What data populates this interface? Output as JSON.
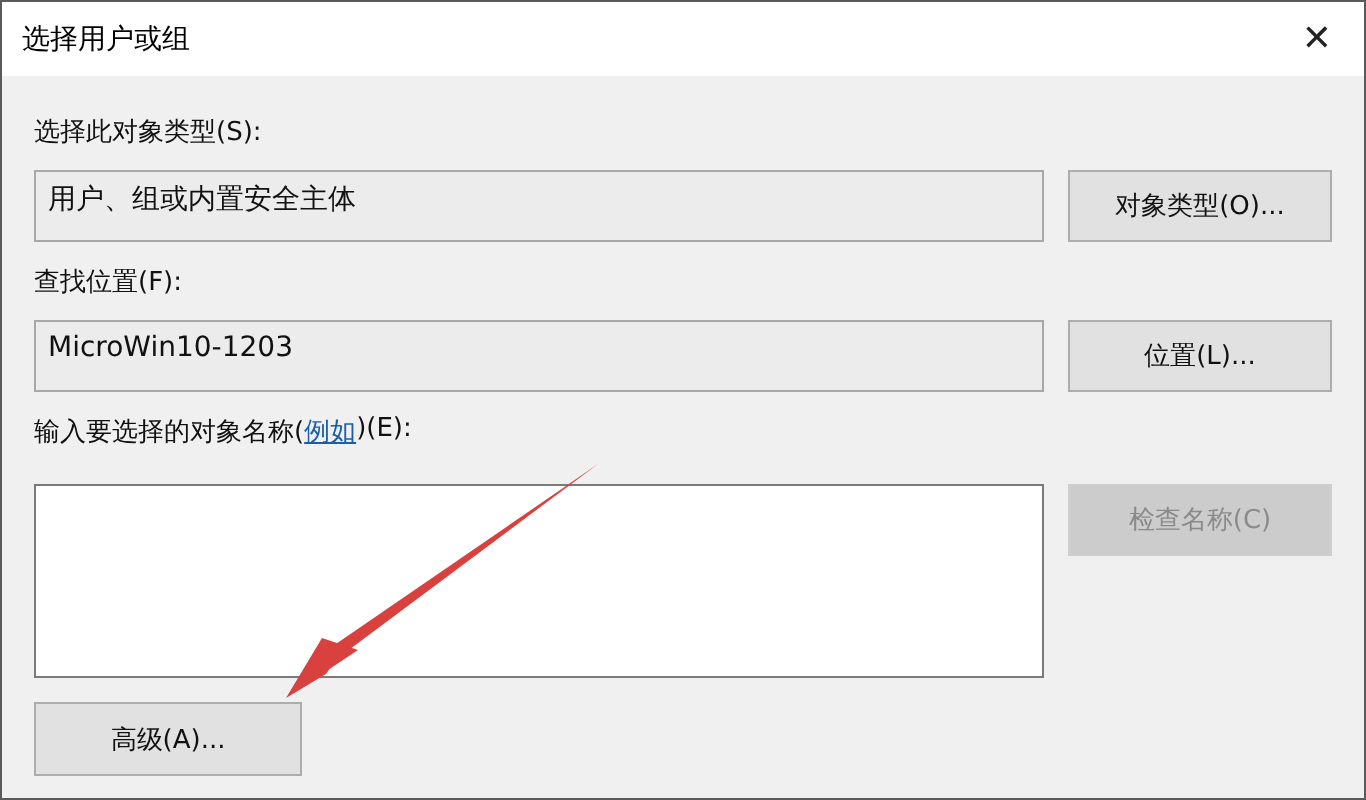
{
  "window": {
    "title": "选择用户或组",
    "close": "✕"
  },
  "rows": [
    {
      "label": "选择此对象类型(S):",
      "value": "用户、组或内置安全主体",
      "button": {
        "label": "对象类型(O)...",
        "disabled": false
      }
    },
    {
      "label": "查找位置(F):",
      "value": "MicroWin10-1203",
      "button": {
        "label": "位置(L)...",
        "disabled": false
      }
    }
  ],
  "names": {
    "label_before": "输入要选择的对象名称(",
    "link": "例如",
    "label_after": ")(E):",
    "button": {
      "label": "检查名称(C)",
      "disabled": true
    }
  },
  "advanced_button": {
    "label": "高级(A)...",
    "disabled": false
  }
}
